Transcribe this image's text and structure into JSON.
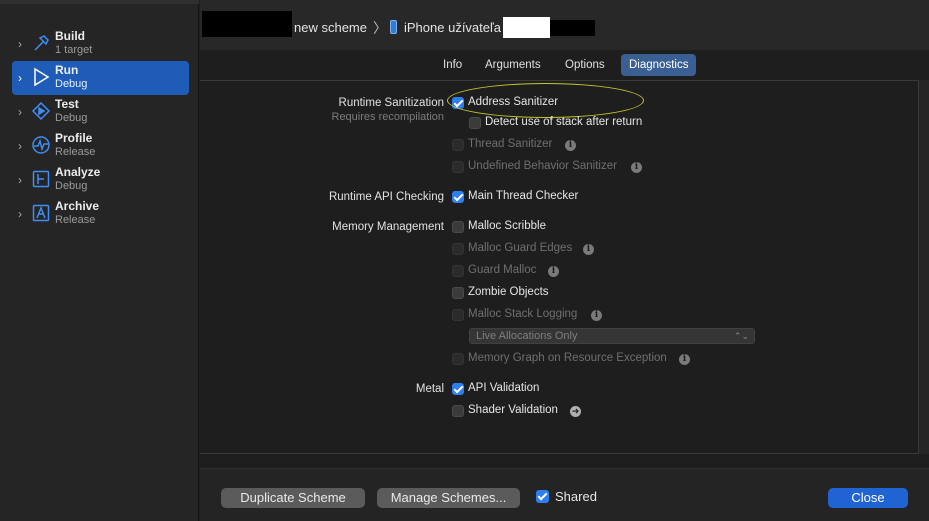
{
  "sidebar": {
    "actions": [
      {
        "name": "Build",
        "sub": "1 target",
        "icon": "hammer-icon"
      },
      {
        "name": "Run",
        "sub": "Debug",
        "icon": "play-icon"
      },
      {
        "name": "Test",
        "sub": "Debug",
        "icon": "test-icon"
      },
      {
        "name": "Profile",
        "sub": "Release",
        "icon": "gauge-icon"
      },
      {
        "name": "Analyze",
        "sub": "Debug",
        "icon": "analyze-icon"
      },
      {
        "name": "Archive",
        "sub": "Release",
        "icon": "archive-icon"
      }
    ]
  },
  "header": {
    "scheme": "new scheme",
    "separator": "〉",
    "destination": "iPhone užívateľa"
  },
  "tabs": [
    "Info",
    "Arguments",
    "Options",
    "Diagnostics"
  ],
  "active_tab": "Diagnostics",
  "diagnostics": {
    "runtime_sanitization": {
      "label": "Runtime Sanitization",
      "sublabel": "Requires recompilation",
      "address_sanitizer": "Address Sanitizer",
      "detect_stack": "Detect use of stack after return",
      "thread_sanitizer": "Thread Sanitizer",
      "ub_sanitizer": "Undefined Behavior Sanitizer"
    },
    "runtime_api": {
      "label": "Runtime API Checking",
      "main_thread_checker": "Main Thread Checker"
    },
    "memory": {
      "label": "Memory Management",
      "malloc_scribble": "Malloc Scribble",
      "malloc_guard_edges": "Malloc Guard Edges",
      "guard_malloc": "Guard Malloc",
      "zombie_objects": "Zombie Objects",
      "malloc_stack_logging": "Malloc Stack Logging",
      "allocations_select": "Live Allocations Only",
      "memory_graph": "Memory Graph on Resource Exception"
    },
    "metal": {
      "label": "Metal",
      "api_validation": "API Validation",
      "shader_validation": "Shader Validation"
    }
  },
  "footer": {
    "duplicate": "Duplicate Scheme",
    "manage": "Manage Schemes...",
    "shared": "Shared",
    "close": "Close"
  },
  "colors": {
    "accent": "#2d7ef2",
    "selected_row": "#1f5cb8",
    "highlight_ellipse": "#c8c52a"
  }
}
